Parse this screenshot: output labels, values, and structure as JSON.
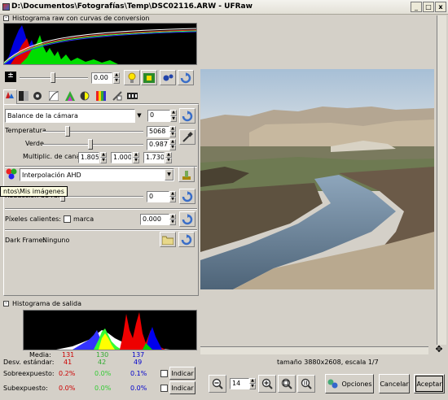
{
  "window": {
    "title": "D:\\Documentos\\Fotografías\\Temp\\DSC02116.ARW - UFRaw",
    "controls": [
      "_",
      "□",
      "x"
    ]
  },
  "raw_histogram": {
    "label": "Histograma raw con curvas de conversion"
  },
  "exposure": {
    "value": "0.00"
  },
  "white_balance": {
    "preset": "Balance de la cámara",
    "fine_tune": "0",
    "temperature_label": "Temperatura",
    "temperature": "5068",
    "green_label": "Verde",
    "green": "0.987",
    "multipliers_label": "Multiplic. de canal:",
    "multipliers": [
      "1.805",
      "1.000",
      "1.730"
    ]
  },
  "interpolation": {
    "value": "Interpolación AHD"
  },
  "tooltip": {
    "text": "ntos\\Mis imágenes"
  },
  "noise": {
    "label": "Reducción de ruido",
    "value": "0"
  },
  "hot_pixels": {
    "label": "Píxeles calientes: 0",
    "mark_label": "marca",
    "value": "0.000"
  },
  "dark_frame": {
    "label": "Dark Frame:",
    "value": "Ninguno"
  },
  "output_histogram": {
    "label": "Histograma de salida",
    "mean_label": "Media:",
    "stddev_label": "Desv. estándar:",
    "overexposed_label": "Sobreexpuesto:",
    "underexposed_label": "Subexpuesto:",
    "indicate_label": "Indicar",
    "mean": [
      "131",
      "130",
      "137"
    ],
    "stddev": [
      "41",
      "42",
      "49"
    ],
    "overexposed": [
      "0.2%",
      "0.0%",
      "0.1%"
    ],
    "underexposed": [
      "0.0%",
      "0.0%",
      "0.0%"
    ],
    "colors": {
      "red": "#cc0000",
      "green": "#33cc33",
      "blue": "#0000cc"
    }
  },
  "preview": {
    "status": "tamaño 3880x2608, escala 1/7"
  },
  "zoom": {
    "value": "14"
  },
  "buttons": {
    "options": "Opciones",
    "cancel": "Cancelar",
    "accept": "Aceptar"
  }
}
